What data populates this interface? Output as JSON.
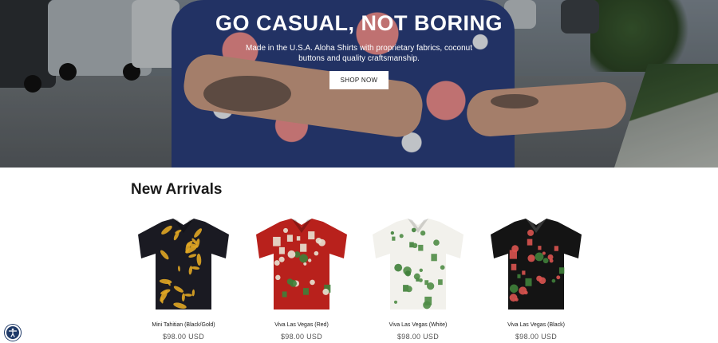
{
  "hero": {
    "title": "GO CASUAL, NOT BORING",
    "subtitle": "Made in the U.S.A. Aloha Shirts with proprietary fabrics, coconut buttons and quality craftsmanship.",
    "cta_label": "SHOP NOW"
  },
  "new_arrivals": {
    "title": "New Arrivals",
    "products": [
      {
        "name": "Mini Tahitian (Black/Gold)",
        "price": "$98.00 USD",
        "base_color": "#1a1a22",
        "print_color": "#e0a623"
      },
      {
        "name": "Viva Las Vegas (Red)",
        "price": "$98.00 USD",
        "base_color": "#b8211c",
        "print_color": "#e8e2d3"
      },
      {
        "name": "Viva Las Vegas (White)",
        "price": "$98.00 USD",
        "base_color": "#f2f1ec",
        "print_color": "#4f8c46"
      },
      {
        "name": "Viva Las Vegas (Black)",
        "price": "$98.00 USD",
        "base_color": "#141414",
        "print_color": "#d9534f"
      }
    ]
  },
  "accessibility": {
    "icon": "accessibility-icon",
    "color": "#1f3a68"
  }
}
